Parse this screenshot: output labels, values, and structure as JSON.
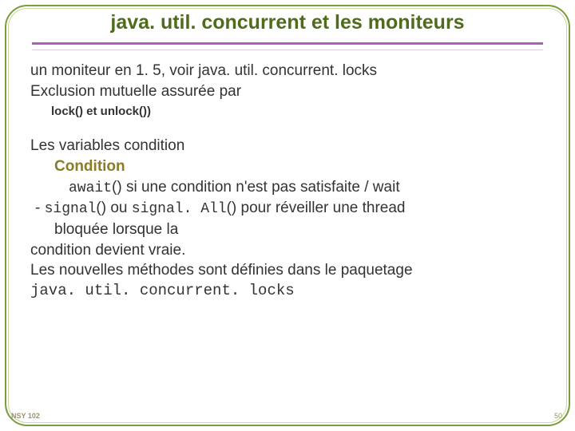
{
  "title": "java. util. concurrent et les moniteurs",
  "content": {
    "line1": " un moniteur en 1. 5, voir java. util. concurrent. locks",
    "line2": "Exclusion mutuelle assurée par",
    "sub1": "lock() et unlock())",
    "line3": "Les variables condition",
    "condition_label": "Condition",
    "await_code": "await",
    "await_rest": "() si une condition n'est pas satisfaite / wait",
    "signal_prefix": "- ",
    "signal_code": "signal",
    "signal_mid": "() ou ",
    "signalall_code": "signal. All",
    "signal_rest": "() pour réveiller une thread",
    "bloquee": "bloquée lorsque la",
    "line4": "condition devient vraie.",
    "line5": "Les nouvelles méthodes sont définies dans le paquetage",
    "line6": "java. util. concurrent. locks"
  },
  "footer": {
    "left": "NSY 102",
    "right": "50"
  }
}
